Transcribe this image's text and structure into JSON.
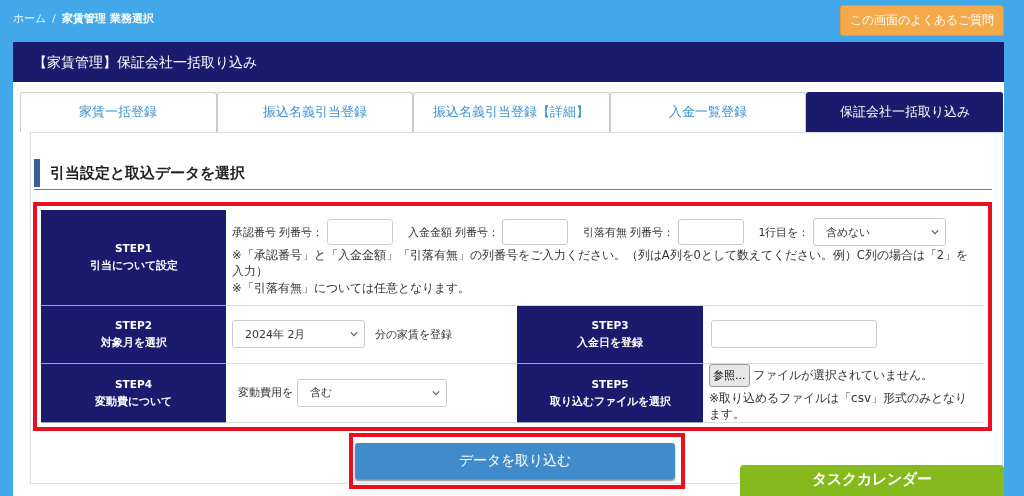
{
  "breadcrumb": [
    {
      "label": "ホーム",
      "current": false
    },
    {
      "label": "家賃管理 業務選択",
      "current": true
    }
  ],
  "breadcrumb_separator": "/",
  "faq_button": "この画面のよくあるご質問",
  "panel_title": "【家賃管理】保証会社一括取り込み",
  "tabs": [
    {
      "label": "家賃一括登録",
      "selected": false
    },
    {
      "label": "振込名義引当登録",
      "selected": false
    },
    {
      "label": "振込名義引当登録【詳細】",
      "selected": false
    },
    {
      "label": "入金一覧登録",
      "selected": false
    },
    {
      "label": "保証会社一括取り込み",
      "selected": true
    }
  ],
  "section_title": "引当設定と取込データを選択",
  "form": {
    "highlighted": true,
    "step1": {
      "step": "STEP1",
      "title": "引当について設定",
      "fields": [
        {
          "label": "承認番号 列番号："
        },
        {
          "label": "入金金額 列番号："
        },
        {
          "label": "引落有無 列番号："
        }
      ],
      "first_row": {
        "label": "1行目を：",
        "value": "含めない"
      },
      "notes": [
        "※「承認番号」と「入金金額」「引落有無」の列番号をご入力ください。（列はA列を0として数えてください。例）C列の場合は「2」を入力）",
        "※「引落有無」については任意となります。"
      ]
    },
    "step2": {
      "step": "STEP2",
      "title": "対象月を選択",
      "value": "2024年 2月",
      "suffix": "分の家賃を登録"
    },
    "step3": {
      "step": "STEP3",
      "title": "入金日を登録"
    },
    "step4": {
      "step": "STEP4",
      "title": "変動費について",
      "label": "変動費用を",
      "value": "含む"
    },
    "step5": {
      "step": "STEP5",
      "title": "取り込むファイルを選択",
      "browse": "参照...",
      "status": "ファイルが選択されていません。",
      "note": "※取り込めるファイルは「csv」形式のみとなります。"
    }
  },
  "import_button": {
    "label": "データを取り込む",
    "highlighted": true
  },
  "task_calendar": "タスクカレンダー"
}
